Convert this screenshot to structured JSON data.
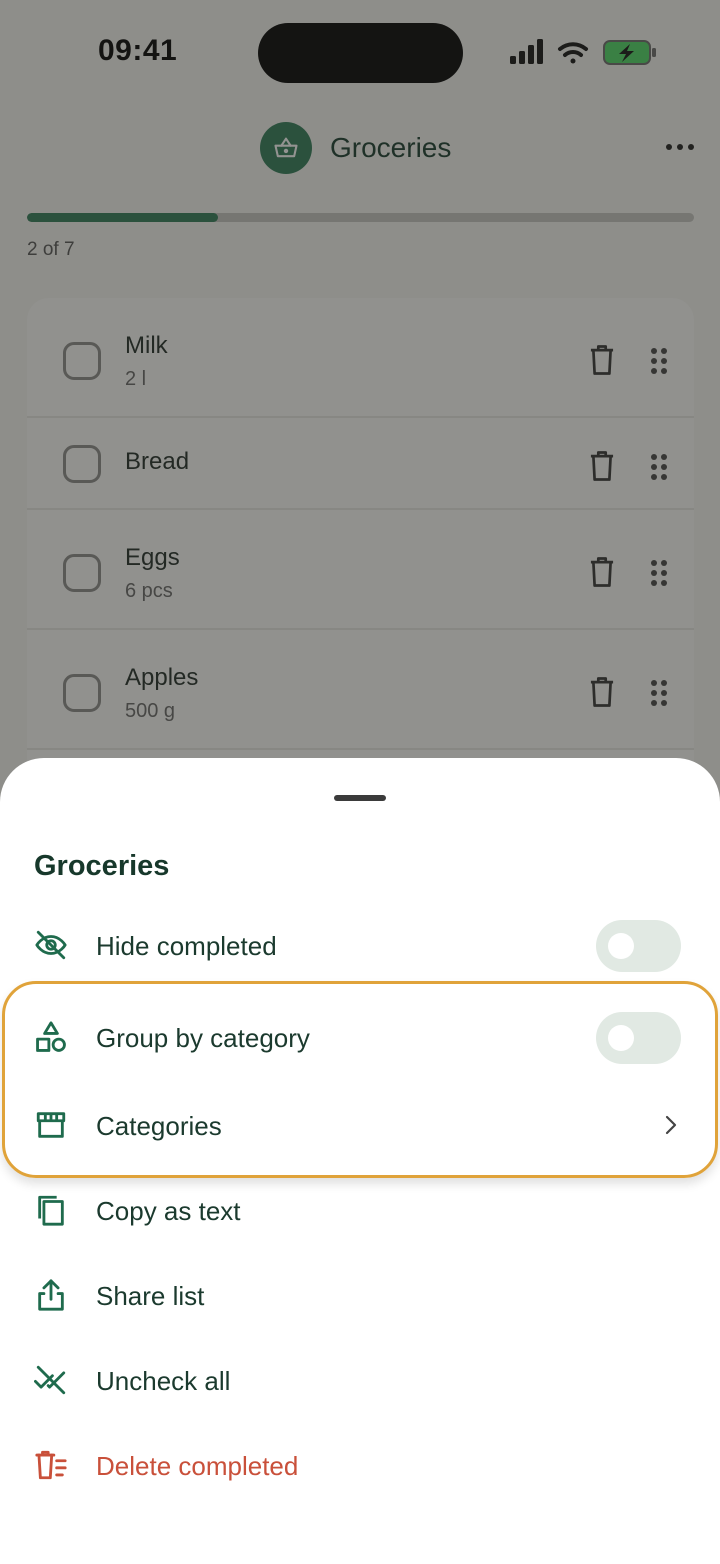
{
  "status_bar": {
    "time": "09:41"
  },
  "header": {
    "title": "Groceries",
    "icon": "basket-icon"
  },
  "progress": {
    "text": "2 of 7",
    "completed": 2,
    "total": 7
  },
  "list": {
    "items": [
      {
        "name": "Milk",
        "qty": "2 l"
      },
      {
        "name": "Bread",
        "qty": ""
      },
      {
        "name": "Eggs",
        "qty": "6 pcs"
      },
      {
        "name": "Apples",
        "qty": "500 g"
      }
    ]
  },
  "sheet": {
    "title": "Groceries",
    "options": [
      {
        "label": "Hide completed",
        "icon": "eye-off-icon",
        "control": "toggle",
        "on": false
      },
      {
        "label": "Group by category",
        "icon": "shapes-icon",
        "control": "toggle",
        "on": false
      },
      {
        "label": "Categories",
        "icon": "store-icon",
        "control": "chevron"
      },
      {
        "label": "Copy as text",
        "icon": "copy-icon"
      },
      {
        "label": "Share list",
        "icon": "share-icon"
      },
      {
        "label": "Uncheck all",
        "icon": "uncheck-all-icon"
      },
      {
        "label": "Delete completed",
        "icon": "delete-completed-icon",
        "danger": true
      }
    ]
  },
  "colors": {
    "accent": "#2f7a57",
    "text_dark": "#1b3a2e",
    "danger": "#c9503a",
    "highlight": "#e0a33a",
    "toggle_off": "#e1e9e3"
  }
}
